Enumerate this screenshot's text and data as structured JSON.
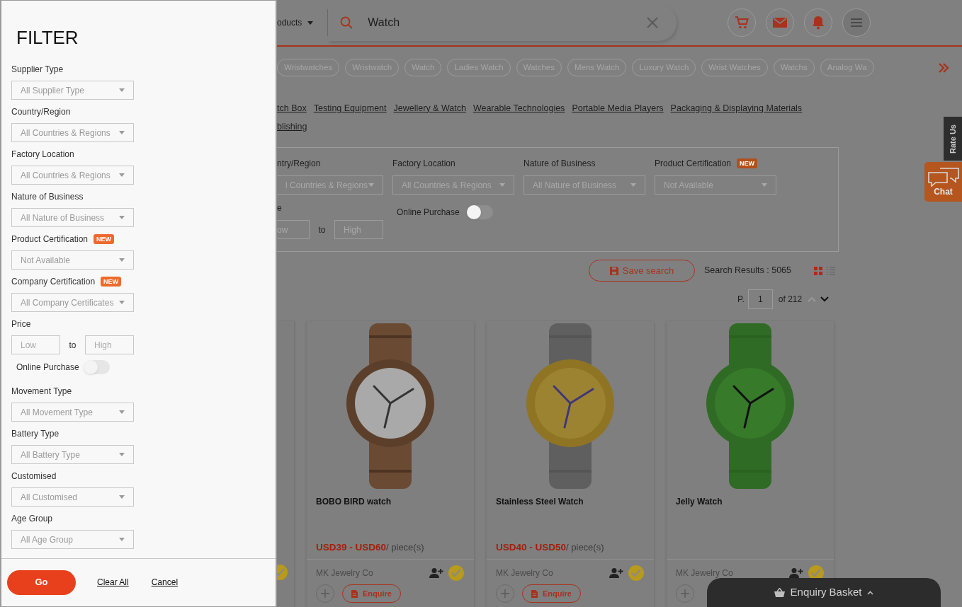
{
  "filter_panel": {
    "title": "FILTER",
    "fields": [
      {
        "kind": "select",
        "label": "Supplier Type",
        "value": "All Supplier Type"
      },
      {
        "kind": "select",
        "label": "Country/Region",
        "value": "All Countries & Regions"
      },
      {
        "kind": "select",
        "label": "Factory Location",
        "value": "All Countries & Regions"
      },
      {
        "kind": "select",
        "label": "Nature of Business",
        "value": "All Nature of Business"
      },
      {
        "kind": "select",
        "label": "Product Certification",
        "badge": "NEW",
        "value": "Not Available"
      },
      {
        "kind": "select",
        "label": "Company Certification",
        "badge": "NEW",
        "value": "All Company Certificates"
      },
      {
        "kind": "range",
        "label": "Price",
        "low_placeholder": "Low",
        "separator": "to",
        "high_placeholder": "High"
      },
      {
        "kind": "toggle",
        "label": "Online Purchase",
        "on": false
      },
      {
        "kind": "select",
        "label": "Movement Type",
        "value": "All Movement Type"
      },
      {
        "kind": "select",
        "label": "Battery Type",
        "value": "All Battery Type"
      },
      {
        "kind": "select",
        "label": "Customised",
        "value": "All Customised"
      },
      {
        "kind": "select",
        "label": "Age Group",
        "value": "All Age Group"
      }
    ],
    "go_button": "Go",
    "clear_link": "Clear All",
    "cancel_link": "Cancel"
  },
  "header": {
    "category_menu": "oducts",
    "search": {
      "value": "Watch"
    }
  },
  "tags": [
    "Wristwatches",
    "Wristwatch",
    "Watch",
    "Ladies Watch",
    "Watches",
    "Mens Watch",
    "Luxury Watch",
    "Wrist Watches",
    "Watchs",
    "Analog Wa"
  ],
  "category_links": [
    [
      "tch Box",
      "Testing Equipment",
      "Jewellery & Watch",
      "Wearable Technologies",
      "Portable Media Players",
      "Packaging & Displaying Materials"
    ],
    [
      "blishing"
    ]
  ],
  "filter_box": {
    "selects": [
      {
        "label": "ntry/Region",
        "value": "l Countries & Regions"
      },
      {
        "label": "Factory Location",
        "value": "All Countries & Regions"
      },
      {
        "label": "Nature of Business",
        "value": "All Nature of Business"
      },
      {
        "label": "Product Certification",
        "badge": "NEW",
        "value": "Not Available"
      }
    ],
    "price": {
      "label": "e",
      "low_placeholder": "ow",
      "separator": "to",
      "high_placeholder": "High"
    },
    "online_purchase": {
      "label": "Online Purchase",
      "on": false
    }
  },
  "results": {
    "save_search": "Save search",
    "count": "Search Results : 5065",
    "views": [
      {
        "kind": "grid",
        "selected": true
      },
      {
        "kind": "list",
        "selected": false
      }
    ]
  },
  "pager": {
    "label": "P.",
    "page": "1",
    "total": "of 212"
  },
  "products": [
    {
      "kind": "wood",
      "name": "BOBO BIRD watch",
      "price": "USD39 - USD60",
      "unit": "/ piece(s)",
      "supplier": "MK Jewelry Co",
      "enquire": "Enquire"
    },
    {
      "kind": "gold",
      "name": "Stainless Steel Watch",
      "price": "USD40 - USD50",
      "unit": "/ piece(s)",
      "supplier": "MK Jewelry Co",
      "enquire": "Enquire"
    },
    {
      "kind": "green",
      "name": "Jelly Watch",
      "supplier": "MK Jewelry Co"
    }
  ],
  "enquiry_basket": "Enquiry Basket",
  "rate_us": "Rate Us",
  "chat": "Chat"
}
